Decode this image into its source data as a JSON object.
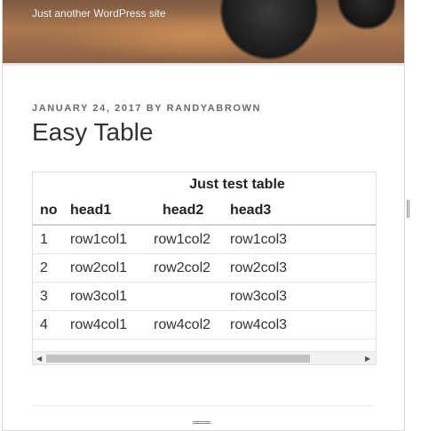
{
  "site": {
    "tagline": "Just another WordPress site"
  },
  "post": {
    "meta": "JANUARY 24, 2017 BY RANDYABROWN",
    "title": "Easy Table"
  },
  "table": {
    "caption": "Just test table",
    "headers": [
      "no",
      "head1",
      "head2",
      "head3"
    ],
    "rows": [
      [
        "1",
        "row1col1",
        "row1col2",
        "row1col3"
      ],
      [
        "2",
        "row2col1",
        "row2col2",
        "row2col3"
      ],
      [
        "3",
        "row3col1",
        "",
        "row3col3"
      ],
      [
        "4",
        "row4col1",
        "row4col2",
        "row4col3"
      ]
    ]
  },
  "icons": {
    "scroll_left": "triangle-left",
    "scroll_right": "triangle-right",
    "resize_grip": "grip-lines"
  }
}
